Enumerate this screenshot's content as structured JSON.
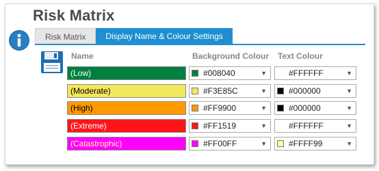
{
  "title": "Risk Matrix",
  "tabs": [
    {
      "label": "Risk Matrix",
      "active": false
    },
    {
      "label": "Display Name & Colour Settings",
      "active": true
    }
  ],
  "columns": {
    "name": "Name",
    "background": "Background Colour",
    "text": "Text Colour"
  },
  "rows": [
    {
      "name": "(Low)",
      "bg": "#008040",
      "bg_label": "#008040",
      "text": "#FFFFFF",
      "text_label": "#FFFFFF"
    },
    {
      "name": "(Moderate)",
      "bg": "#F3E85C",
      "bg_label": "#F3E85C",
      "text": "#000000",
      "text_label": "#000000"
    },
    {
      "name": "(High)",
      "bg": "#FF9900",
      "bg_label": "#FF9900",
      "text": "#000000",
      "text_label": "#000000"
    },
    {
      "name": "(Extreme)",
      "bg": "#FF1519",
      "bg_label": "#FF1519",
      "text": "#FFFFFF",
      "text_label": "#FFFFFF"
    },
    {
      "name": "(Catastrophic)",
      "bg": "#FF00FF",
      "bg_label": "#FF00FF",
      "text": "#FFFF99",
      "text_label": "#FFFF99"
    }
  ],
  "icons": {
    "info": "info-icon",
    "save": "floppy-disk-icon",
    "dropdown": "chevron-down-icon"
  },
  "accent_color": "#1E8FD0"
}
